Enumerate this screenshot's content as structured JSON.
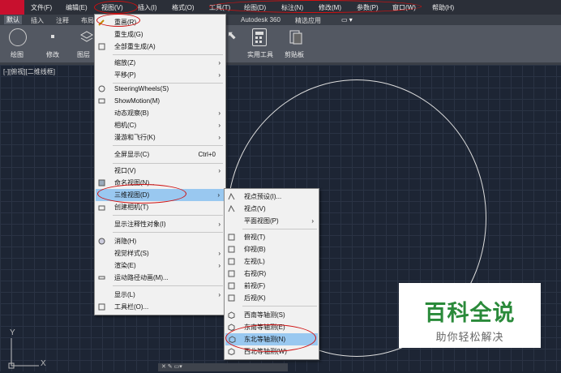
{
  "menubar": {
    "items": [
      "文件(F)",
      "编辑(E)",
      "视图(V)",
      "插入(I)",
      "格式(O)",
      "工具(T)",
      "绘图(D)",
      "标注(N)",
      "修改(M)",
      "参数(P)",
      "窗口(W)",
      "帮助(H)"
    ]
  },
  "tabs": {
    "items": [
      "默认",
      "插入",
      "注释",
      "布局",
      "Autodesk 360",
      "精选应用"
    ],
    "active": "默认"
  },
  "ribbon": {
    "buttons": [
      "绘图",
      "修改",
      "图层",
      "实用工具",
      "剪贴板"
    ]
  },
  "viewport": {
    "label": "[-][俯视][二维线框]"
  },
  "view_menu": {
    "items": [
      {
        "label": "重画(R)",
        "icon": "pencil-icon"
      },
      {
        "label": "重生成(G)"
      },
      {
        "label": "全部重生成(A)",
        "icon": "regen-icon"
      },
      {
        "label": "缩放(Z)",
        "submenu": true
      },
      {
        "label": "平移(P)",
        "submenu": true
      },
      {
        "label": "SteeringWheels(S)",
        "icon": "wheel-icon"
      },
      {
        "label": "ShowMotion(M)",
        "icon": "showmotion-icon"
      },
      {
        "label": "动态观察(B)",
        "submenu": true
      },
      {
        "label": "相机(C)",
        "submenu": true
      },
      {
        "label": "漫游和飞行(K)",
        "submenu": true
      },
      {
        "label": "全屏显示(C)",
        "shortcut": "Ctrl+0"
      },
      {
        "label": "视口(V)",
        "submenu": true
      },
      {
        "label": "命名视图(N)...",
        "icon": "named-view-icon"
      },
      {
        "label": "三维视图(D)",
        "submenu": true,
        "highlight": true
      },
      {
        "label": "创建相机(T)",
        "icon": "camera-icon"
      },
      {
        "label": "显示注释性对象(I)",
        "submenu": true
      },
      {
        "label": "消隐(H)",
        "icon": "hide-icon"
      },
      {
        "label": "视觉样式(S)",
        "submenu": true
      },
      {
        "label": "渲染(E)",
        "submenu": true
      },
      {
        "label": "运动路径动画(M)...",
        "icon": "motion-path-icon"
      },
      {
        "label": "显示(L)",
        "submenu": true
      },
      {
        "label": "工具栏(O)...",
        "icon": "toolbar-icon"
      }
    ]
  },
  "view3d_submenu": {
    "items": [
      {
        "label": "视点预设(I)..."
      },
      {
        "label": "视点(V)"
      },
      {
        "label": "平面视图(P)",
        "submenu": true
      },
      {
        "label": "俯视(T)"
      },
      {
        "label": "仰视(B)"
      },
      {
        "label": "左视(L)"
      },
      {
        "label": "右视(R)"
      },
      {
        "label": "前视(F)"
      },
      {
        "label": "后视(K)"
      },
      {
        "label": "西南等轴测(S)"
      },
      {
        "label": "东南等轴测(E)"
      },
      {
        "label": "东北等轴测(N)",
        "highlight": true
      },
      {
        "label": "西北等轴测(W)"
      }
    ]
  },
  "watermark": {
    "title": "百科全说",
    "subtitle": "助你轻松解决"
  },
  "axes": {
    "x": "X",
    "y": "Y"
  },
  "colors": {
    "highlight": "#99c8f0",
    "annotation": "#d01010",
    "watermark_green": "#2a8a3a"
  }
}
